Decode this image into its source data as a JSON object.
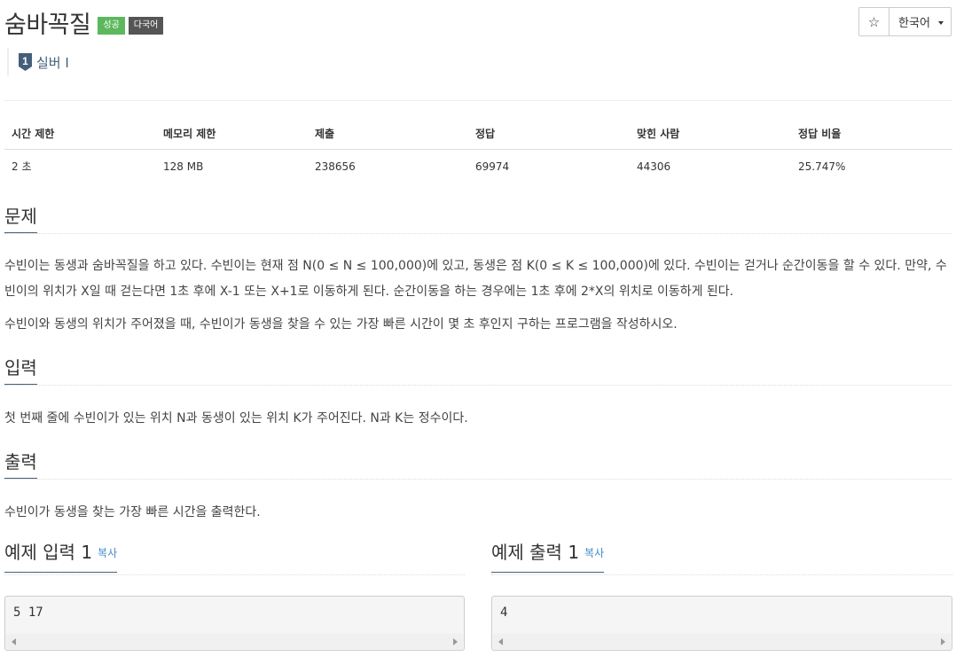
{
  "problem": {
    "title": "숨바꼭질",
    "badges": {
      "success": "성공",
      "multilang": "다국어"
    },
    "tier": {
      "icon_text": "1",
      "label": "실버 I",
      "color": "#435f7a"
    }
  },
  "toolbar": {
    "star_icon": "☆",
    "language": "한국어"
  },
  "info": {
    "headers": [
      "시간 제한",
      "메모리 제한",
      "제출",
      "정답",
      "맞힌 사람",
      "정답 비율"
    ],
    "values": [
      "2 초",
      "128 MB",
      "238656",
      "69974",
      "44306",
      "25.747%"
    ]
  },
  "sections": {
    "problem": {
      "heading": "문제",
      "p1": "수빈이는 동생과 숨바꼭질을 하고 있다. 수빈이는 현재 점 N(0 ≤ N ≤ 100,000)에 있고, 동생은 점 K(0 ≤ K ≤ 100,000)에 있다. 수빈이는 걷거나 순간이동을 할 수 있다. 만약, 수빈이의 위치가 X일 때 걷는다면 1초 후에 X-1 또는 X+1로 이동하게 된다. 순간이동을 하는 경우에는 1초 후에 2*X의 위치로 이동하게 된다.",
      "p2": "수빈이와 동생의 위치가 주어졌을 때, 수빈이가 동생을 찾을 수 있는 가장 빠른 시간이 몇 초 후인지 구하는 프로그램을 작성하시오."
    },
    "input": {
      "heading": "입력",
      "p1": "첫 번째 줄에 수빈이가 있는 위치 N과 동생이 있는 위치 K가 주어진다. N과 K는 정수이다."
    },
    "output": {
      "heading": "출력",
      "p1": "수빈이가 동생을 찾는 가장 빠른 시간을 출력한다."
    }
  },
  "examples": {
    "input": {
      "heading": "예제 입력 1",
      "copy": "복사",
      "content": "5 17"
    },
    "output": {
      "heading": "예제 출력 1",
      "copy": "복사",
      "content": "4"
    }
  }
}
